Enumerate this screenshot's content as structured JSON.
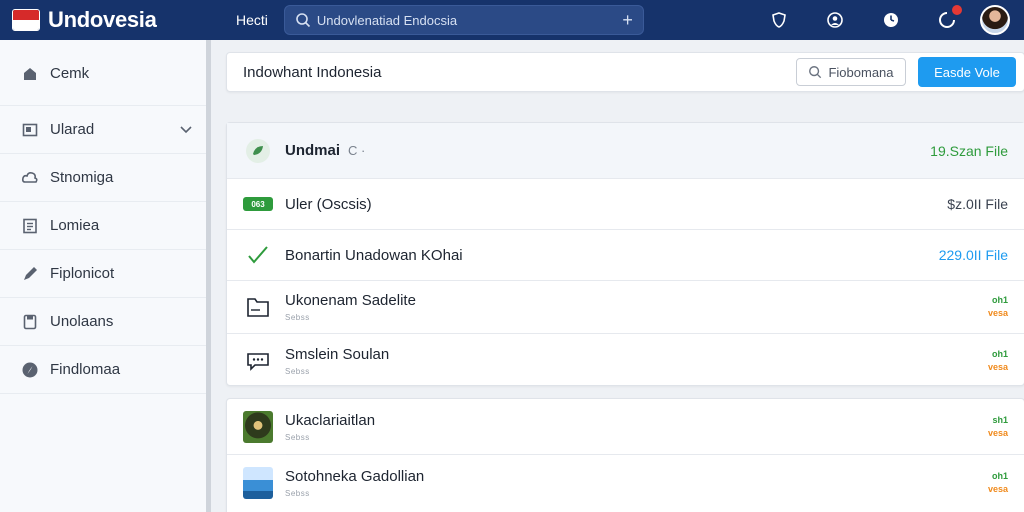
{
  "app": {
    "brand": "Undovesia",
    "nav_link": "Hecti",
    "search_placeholder": "Undovlenatiad Endocsia"
  },
  "colors": {
    "topbar": "#16336b",
    "primary": "#1e9bf0",
    "green": "#2e9b3c",
    "orange": "#f08a1c"
  },
  "sidebar": {
    "items": [
      {
        "label": "Cemk",
        "icon": "home-icon"
      },
      {
        "label": "Ularad",
        "icon": "square-icon",
        "has_chevron": true
      },
      {
        "label": "Stnomiga",
        "icon": "cloud-icon"
      },
      {
        "label": "Lomiea",
        "icon": "list-icon"
      },
      {
        "label": "Fiplonicot",
        "icon": "pen-icon"
      },
      {
        "label": "Unolaans",
        "icon": "document-icon"
      },
      {
        "label": "Findlomaa",
        "icon": "compass-icon"
      }
    ]
  },
  "header": {
    "title": "Indowhant Indonesia",
    "secondary_button": "Fiobomana",
    "primary_button": "Easde Vole"
  },
  "list": {
    "head": {
      "title": "Undmai",
      "suffix": "C  ·",
      "right": "19.Szan File"
    },
    "rows": [
      {
        "badge": "063",
        "title": "Uler (Oscsis)",
        "right": "$z.0II File"
      },
      {
        "title": "Bonartin Unadowan KOhai",
        "right": "229.0II File"
      },
      {
        "title": "Ukonenam Sadelite",
        "sub": "Sebss",
        "stack_top": "oh1",
        "stack_bottom": "vesa"
      },
      {
        "title": "Smslein Soulan",
        "sub": "Sebss",
        "stack_top": "oh1",
        "stack_bottom": "vesa"
      }
    ]
  },
  "list2": {
    "rows": [
      {
        "title": "Ukaclariaitlan",
        "sub": "Sebss",
        "stack_top": "sh1",
        "stack_bottom": "vesa"
      },
      {
        "title": "Sotohneka Gadollian",
        "sub": "Sebss",
        "stack_top": "oh1",
        "stack_bottom": "vesa"
      }
    ]
  }
}
